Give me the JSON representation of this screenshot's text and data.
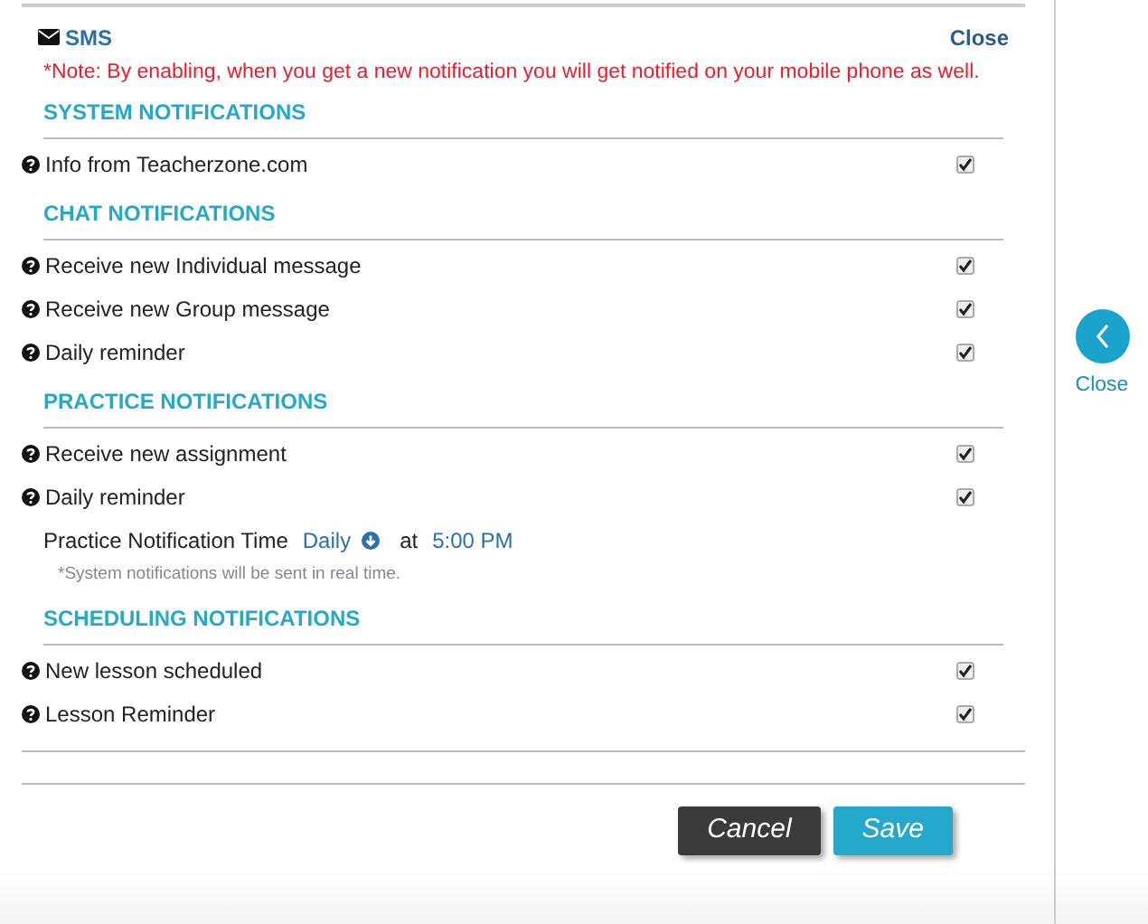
{
  "header": {
    "title": "SMS",
    "close": "Close"
  },
  "note": "*Note: By enabling, when you get a new notification you will get notified on your mobile phone as well.",
  "sections": [
    {
      "heading": "SYSTEM NOTIFICATIONS",
      "items": [
        {
          "label": "Info from Teacherzone.com",
          "checked": true
        }
      ]
    },
    {
      "heading": "CHAT NOTIFICATIONS",
      "items": [
        {
          "label": "Receive new Individual message",
          "checked": true
        },
        {
          "label": "Receive new Group message",
          "checked": true
        },
        {
          "label": "Daily reminder",
          "checked": true
        }
      ]
    },
    {
      "heading": "PRACTICE NOTIFICATIONS",
      "items": [
        {
          "label": "Receive new assignment",
          "checked": true
        },
        {
          "label": "Daily reminder",
          "checked": true
        }
      ],
      "time_setting": {
        "label": "Practice Notification Time",
        "frequency": "Daily",
        "at": "at",
        "time": "5:00 PM",
        "footnote": "*System notifications will be sent in real time."
      }
    },
    {
      "heading": "SCHEDULING NOTIFICATIONS",
      "items": [
        {
          "label": "New lesson scheduled",
          "checked": true
        },
        {
          "label": "Lesson Reminder",
          "checked": true
        }
      ]
    }
  ],
  "buttons": [
    {
      "kind": "cancel",
      "label": "Cancel"
    },
    {
      "kind": "save",
      "label": "Save"
    }
  ],
  "side": {
    "close": "Close"
  }
}
